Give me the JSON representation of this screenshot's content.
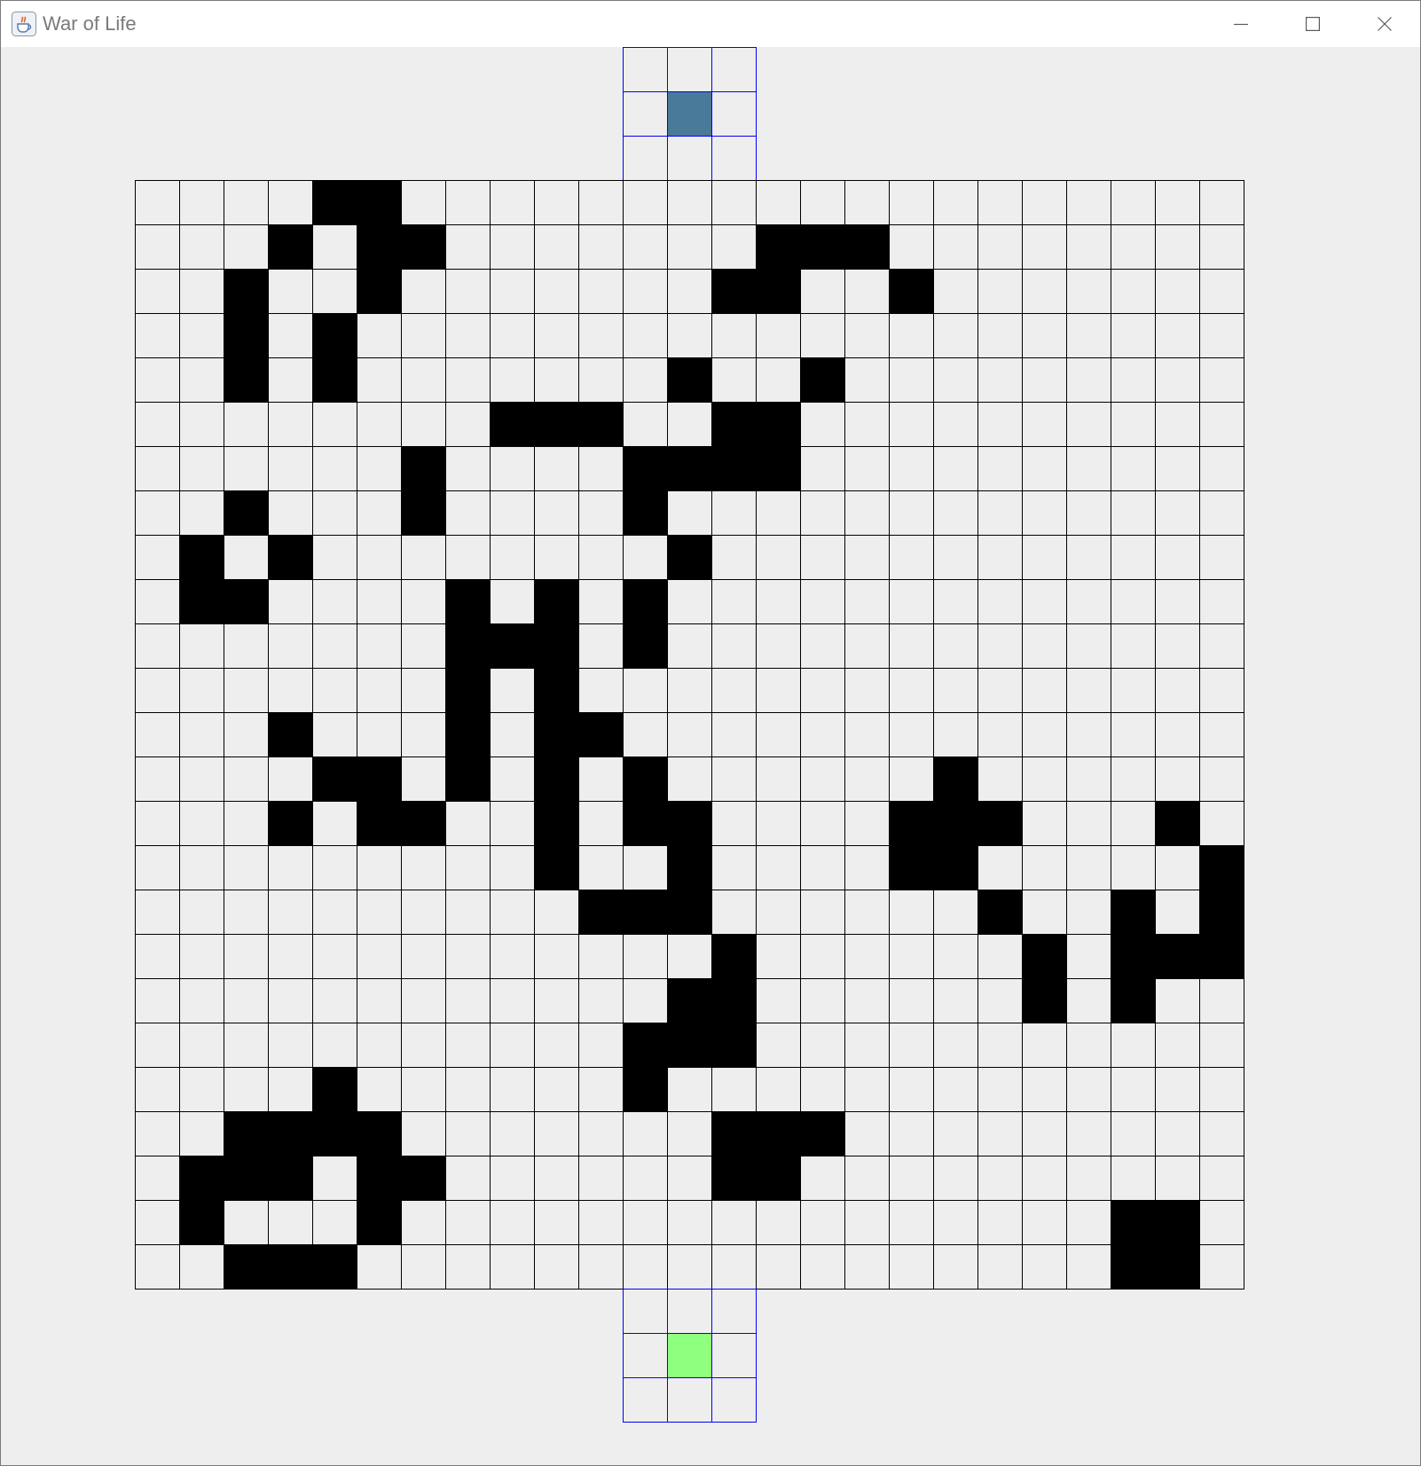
{
  "window": {
    "title": "War of Life",
    "app_icon": "java-coffee-cup-icon",
    "controls": [
      "minimize-icon",
      "maximize-icon",
      "close-icon"
    ]
  },
  "colors": {
    "live_cell": "#000000",
    "dead_cell": "#eeeeee",
    "main_grid_line": "#000000",
    "side_grid_line": "#0000ff",
    "top_player_marker": "#4a7a9a",
    "bottom_player_marker": "#8fff80"
  },
  "board": {
    "rows": 25,
    "cols": 25,
    "live_cells": [
      [
        0,
        4
      ],
      [
        0,
        5
      ],
      [
        1,
        3
      ],
      [
        1,
        5
      ],
      [
        1,
        6
      ],
      [
        1,
        14
      ],
      [
        1,
        15
      ],
      [
        1,
        16
      ],
      [
        2,
        2
      ],
      [
        2,
        5
      ],
      [
        2,
        13
      ],
      [
        2,
        14
      ],
      [
        2,
        17
      ],
      [
        3,
        2
      ],
      [
        3,
        4
      ],
      [
        4,
        2
      ],
      [
        4,
        4
      ],
      [
        4,
        12
      ],
      [
        4,
        15
      ],
      [
        5,
        8
      ],
      [
        5,
        9
      ],
      [
        5,
        10
      ],
      [
        5,
        13
      ],
      [
        5,
        14
      ],
      [
        6,
        6
      ],
      [
        6,
        11
      ],
      [
        6,
        12
      ],
      [
        6,
        13
      ],
      [
        6,
        14
      ],
      [
        7,
        2
      ],
      [
        7,
        6
      ],
      [
        7,
        11
      ],
      [
        8,
        1
      ],
      [
        8,
        3
      ],
      [
        8,
        12
      ],
      [
        9,
        1
      ],
      [
        9,
        2
      ],
      [
        9,
        7
      ],
      [
        9,
        9
      ],
      [
        9,
        11
      ],
      [
        10,
        7
      ],
      [
        10,
        8
      ],
      [
        10,
        9
      ],
      [
        10,
        11
      ],
      [
        11,
        7
      ],
      [
        11,
        9
      ],
      [
        12,
        3
      ],
      [
        12,
        7
      ],
      [
        12,
        9
      ],
      [
        12,
        10
      ],
      [
        13,
        4
      ],
      [
        13,
        5
      ],
      [
        13,
        7
      ],
      [
        13,
        9
      ],
      [
        13,
        11
      ],
      [
        13,
        18
      ],
      [
        14,
        3
      ],
      [
        14,
        5
      ],
      [
        14,
        6
      ],
      [
        14,
        9
      ],
      [
        14,
        11
      ],
      [
        14,
        12
      ],
      [
        14,
        17
      ],
      [
        14,
        18
      ],
      [
        14,
        19
      ],
      [
        14,
        23
      ],
      [
        15,
        9
      ],
      [
        15,
        12
      ],
      [
        15,
        17
      ],
      [
        15,
        18
      ],
      [
        15,
        24
      ],
      [
        16,
        10
      ],
      [
        16,
        11
      ],
      [
        16,
        12
      ],
      [
        16,
        19
      ],
      [
        16,
        22
      ],
      [
        16,
        24
      ],
      [
        17,
        13
      ],
      [
        17,
        20
      ],
      [
        17,
        22
      ],
      [
        17,
        23
      ],
      [
        17,
        24
      ],
      [
        18,
        12
      ],
      [
        18,
        13
      ],
      [
        18,
        20
      ],
      [
        18,
        22
      ],
      [
        19,
        11
      ],
      [
        19,
        12
      ],
      [
        19,
        13
      ],
      [
        20,
        4
      ],
      [
        20,
        11
      ],
      [
        21,
        2
      ],
      [
        21,
        3
      ],
      [
        21,
        4
      ],
      [
        21,
        5
      ],
      [
        21,
        13
      ],
      [
        21,
        14
      ],
      [
        21,
        15
      ],
      [
        22,
        1
      ],
      [
        22,
        2
      ],
      [
        22,
        3
      ],
      [
        22,
        5
      ],
      [
        22,
        6
      ],
      [
        22,
        13
      ],
      [
        22,
        14
      ],
      [
        23,
        1
      ],
      [
        23,
        5
      ],
      [
        23,
        22
      ],
      [
        23,
        23
      ],
      [
        24,
        2
      ],
      [
        24,
        3
      ],
      [
        24,
        4
      ],
      [
        24,
        22
      ],
      [
        24,
        23
      ]
    ]
  },
  "top_player_grid": {
    "rows": 3,
    "cols": 3,
    "marker_cell": [
      1,
      1
    ]
  },
  "bottom_player_grid": {
    "rows": 3,
    "cols": 3,
    "marker_cell": [
      1,
      1
    ]
  }
}
